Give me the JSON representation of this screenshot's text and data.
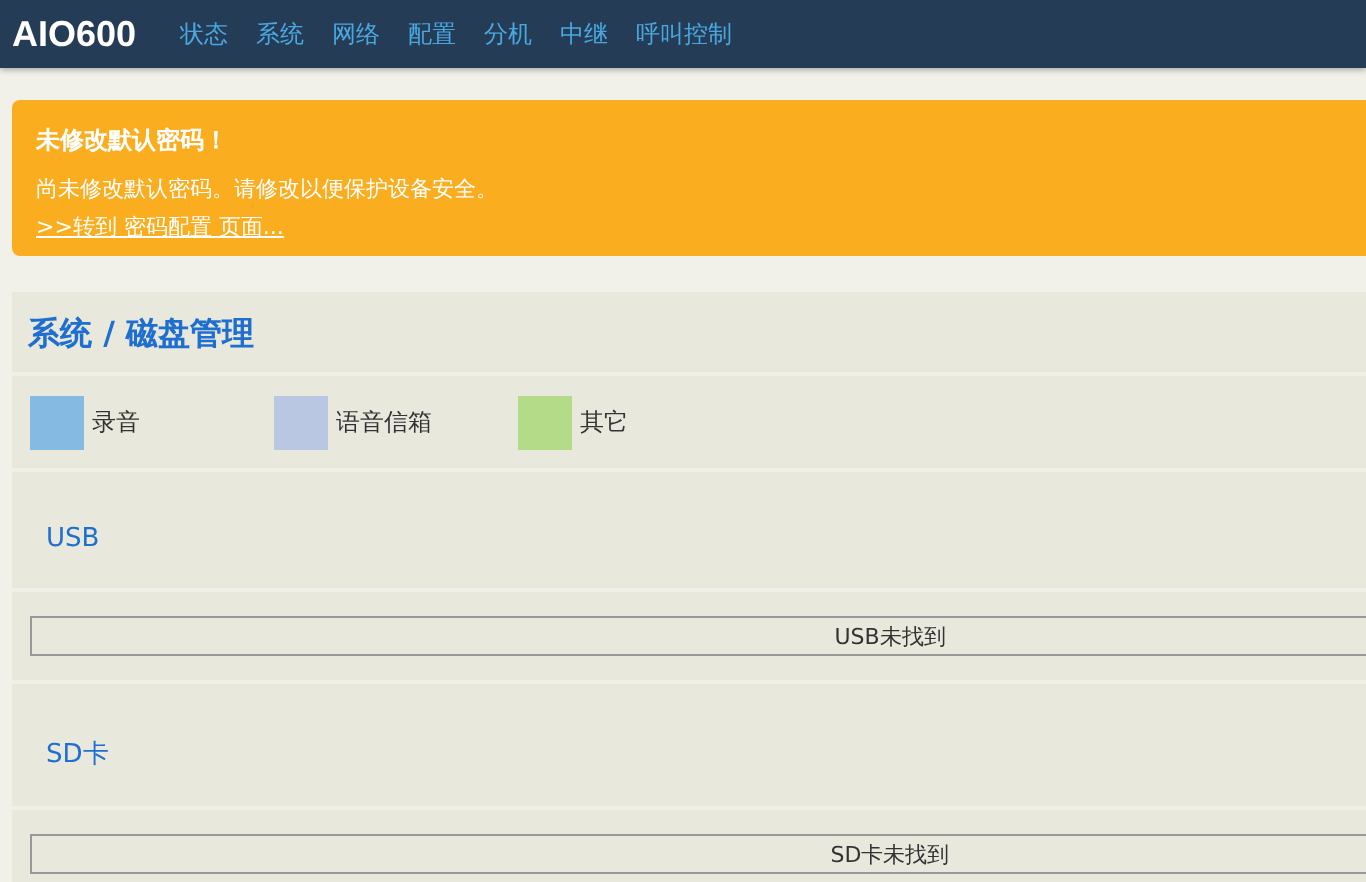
{
  "brand": "AIO600",
  "nav": [
    "状态",
    "系统",
    "网络",
    "配置",
    "分机",
    "中继",
    "呼叫控制"
  ],
  "alert": {
    "title": "未修改默认密码！",
    "message": "尚未修改默认密码。请修改以便保护设备安全。",
    "link": ">>转到 密码配置 页面..."
  },
  "page_title": "系统 / 磁盘管理",
  "legend": [
    {
      "label": "录音",
      "color": "#85bbe3"
    },
    {
      "label": "语音信箱",
      "color": "#b9c7e3"
    },
    {
      "label": "其它",
      "color": "#b4dc88"
    }
  ],
  "storages": [
    {
      "name": "USB",
      "status": "USB未找到"
    },
    {
      "name": "SD卡",
      "status": "SD卡未找到"
    }
  ]
}
